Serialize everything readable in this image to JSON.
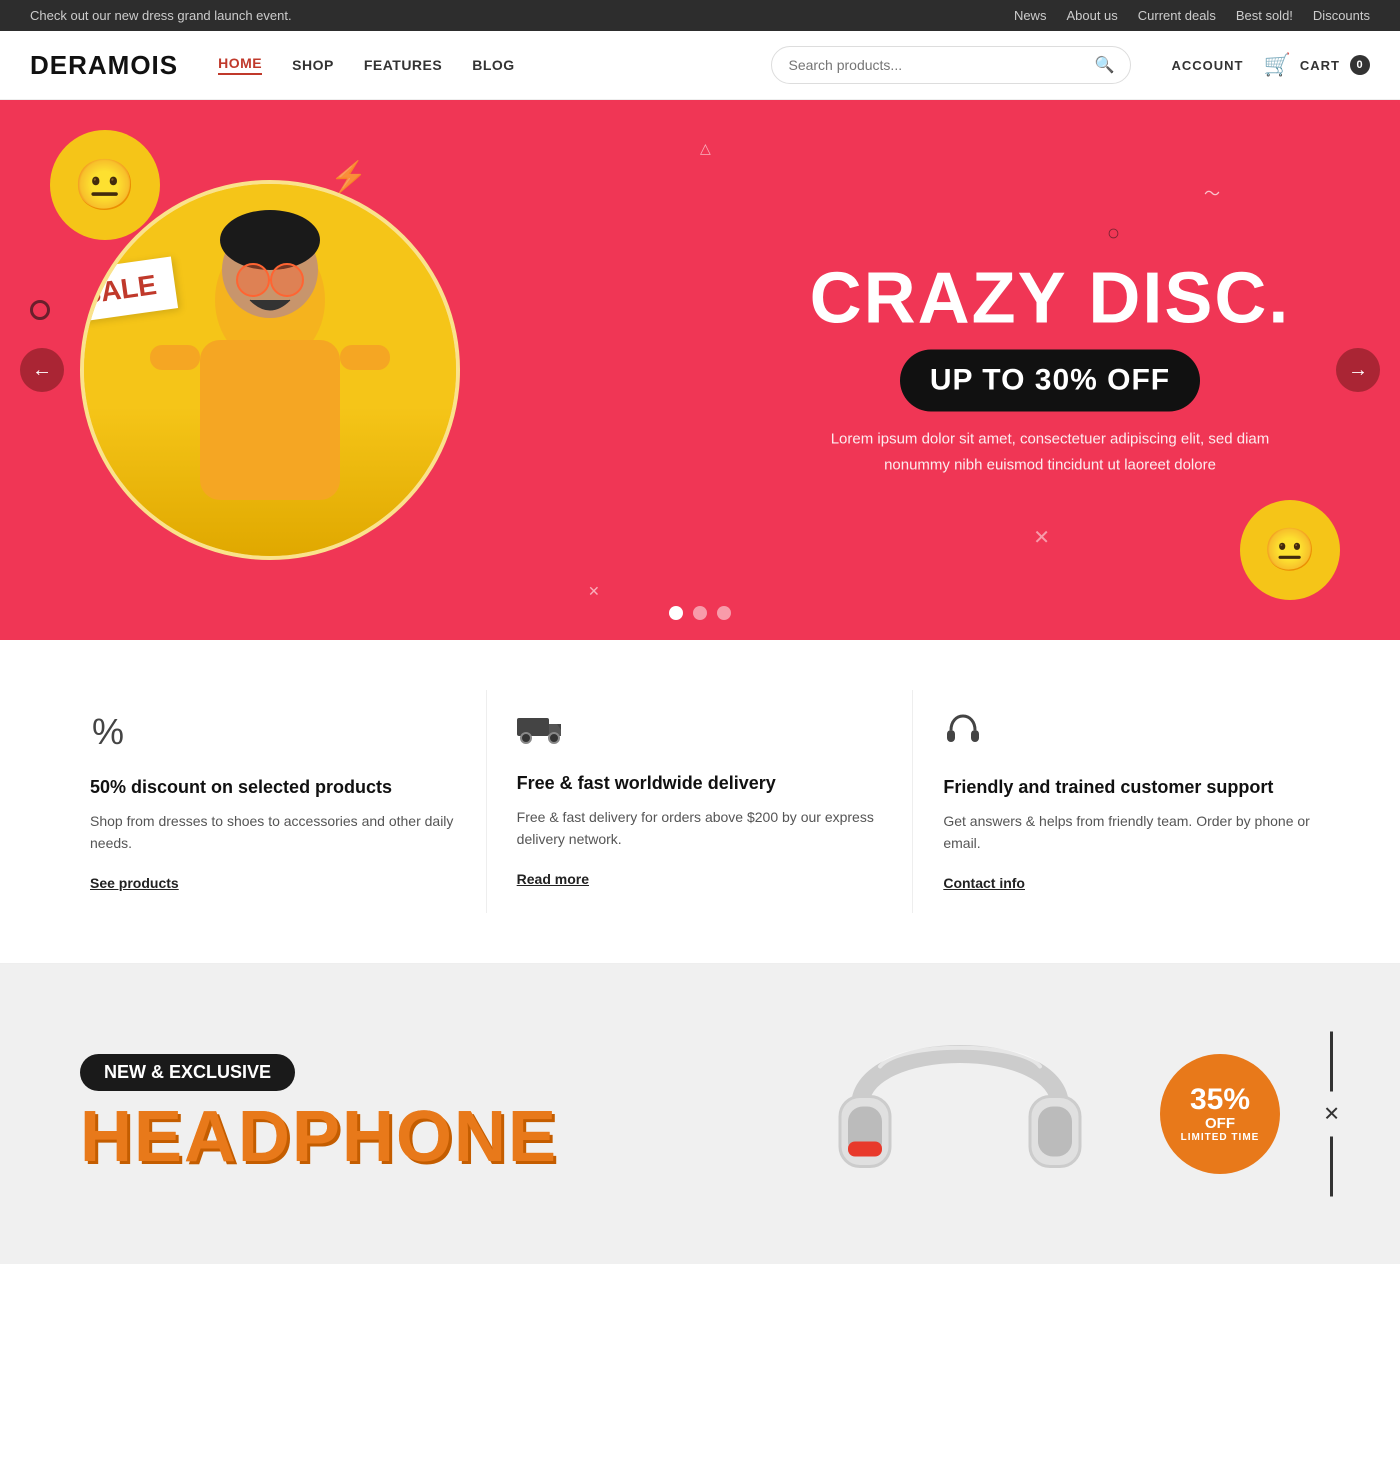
{
  "topbar": {
    "announcement": "Check out our new dress grand launch event.",
    "links": [
      {
        "label": "News",
        "href": "#"
      },
      {
        "label": "About us",
        "href": "#"
      },
      {
        "label": "Current deals",
        "href": "#"
      },
      {
        "label": "Best sold!",
        "href": "#"
      },
      {
        "label": "Discounts",
        "href": "#"
      }
    ]
  },
  "header": {
    "logo": "DERAMOIS",
    "nav": [
      {
        "label": "HOME",
        "active": true
      },
      {
        "label": "SHOP",
        "active": false
      },
      {
        "label": "FEATURES",
        "active": false
      },
      {
        "label": "BLOG",
        "active": false
      }
    ],
    "search_placeholder": "Search products...",
    "account_label": "ACCOUNT",
    "cart_label": "CART",
    "cart_count": "0"
  },
  "hero": {
    "tag": "SALE",
    "title": "CRAZY DISC.",
    "subtitle": "UP TO 30% OFF",
    "description": "Lorem ipsum dolor sit amet, consectetuer adipiscing elit, sed diam nonummy nibh euismod tincidunt ut laoreet dolore",
    "prev_label": "←",
    "next_label": "→",
    "dots": [
      {
        "active": true
      },
      {
        "active": false
      },
      {
        "active": false
      }
    ]
  },
  "features": [
    {
      "icon": "percent",
      "title": "50% discount on selected products",
      "desc": "Shop from dresses to shoes to accessories and other daily needs.",
      "link": "See products"
    },
    {
      "icon": "truck",
      "title": "Free & fast worldwide delivery",
      "desc": "Free & fast delivery for orders above $200 by our express delivery network.",
      "link": "Read more"
    },
    {
      "icon": "headphones",
      "title": "Friendly and trained customer support",
      "desc": "Get answers & helps from friendly team. Order by phone or email.",
      "link": "Contact info"
    }
  ],
  "product_banner": {
    "badge": "NEW & EXCLUSIVE",
    "title": "HEADPHONE",
    "discount_pct": "35%",
    "discount_off": "OFF",
    "discount_ltd": "LIMITED TIME"
  }
}
